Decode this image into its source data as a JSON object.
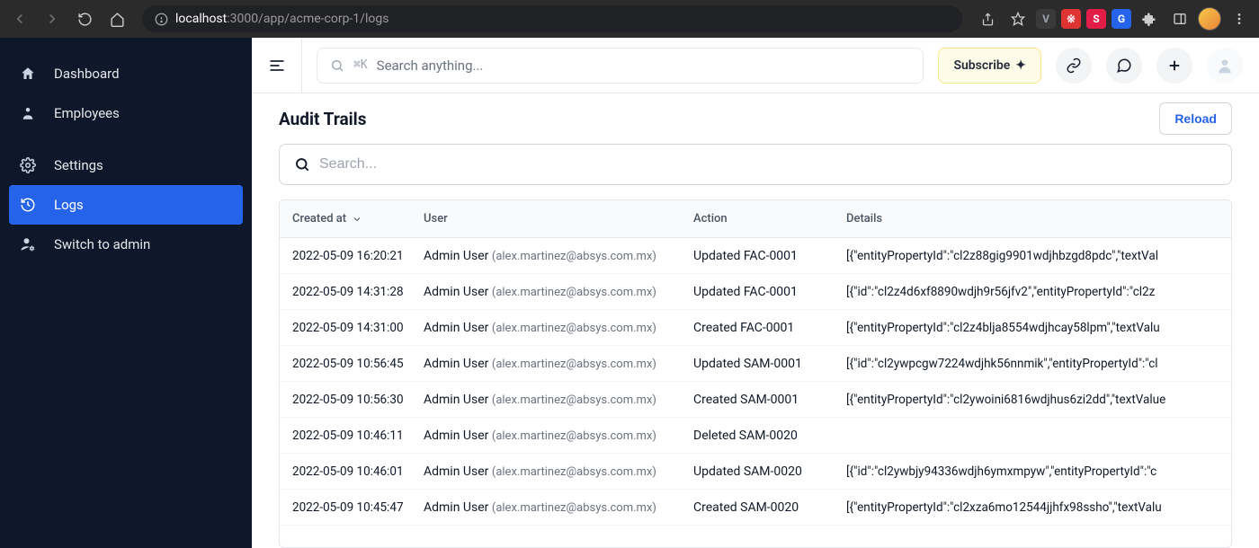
{
  "browser": {
    "url_host": "localhost",
    "url_port_path": ":3000/app/acme-corp-1/logs"
  },
  "sidebar": {
    "items": [
      {
        "icon": "home-icon",
        "label": "Dashboard"
      },
      {
        "icon": "person-icon",
        "label": "Employees"
      }
    ],
    "items2": [
      {
        "icon": "gear-icon",
        "label": "Settings"
      },
      {
        "icon": "history-icon",
        "label": "Logs",
        "active": true
      },
      {
        "icon": "admin-icon",
        "label": "Switch to admin"
      }
    ]
  },
  "topbar": {
    "search_shortcut": "⌘K",
    "search_placeholder": "Search anything...",
    "subscribe_label": "Subscribe"
  },
  "page": {
    "title": "Audit Trails",
    "reload_label": "Reload",
    "table_search_placeholder": "Search..."
  },
  "table": {
    "columns": {
      "created_at": "Created at",
      "user": "User",
      "action": "Action",
      "details": "Details"
    },
    "rows": [
      {
        "created_at": "2022-05-09 16:20:21",
        "user_name": "Admin User",
        "user_email": "(alex.martinez@absys.com.mx)",
        "action": "Updated FAC-0001",
        "details": "[{\"entityPropertyId\":\"cl2z88gig9901wdjhbzgd8pdc\",\"textVal"
      },
      {
        "created_at": "2022-05-09 14:31:28",
        "user_name": "Admin User",
        "user_email": "(alex.martinez@absys.com.mx)",
        "action": "Updated FAC-0001",
        "details": "[{\"id\":\"cl2z4d6xf8890wdjh9r56jfv2\",\"entityPropertyId\":\"cl2z"
      },
      {
        "created_at": "2022-05-09 14:31:00",
        "user_name": "Admin User",
        "user_email": "(alex.martinez@absys.com.mx)",
        "action": "Created FAC-0001",
        "details": "[{\"entityPropertyId\":\"cl2z4blja8554wdjhcay58lpm\",\"textValu"
      },
      {
        "created_at": "2022-05-09 10:56:45",
        "user_name": "Admin User",
        "user_email": "(alex.martinez@absys.com.mx)",
        "action": "Updated SAM-0001",
        "details": "[{\"id\":\"cl2ywpcgw7224wdjhk56nnmik\",\"entityPropertyId\":\"cl"
      },
      {
        "created_at": "2022-05-09 10:56:30",
        "user_name": "Admin User",
        "user_email": "(alex.martinez@absys.com.mx)",
        "action": "Created SAM-0001",
        "details": "[{\"entityPropertyId\":\"cl2ywoini6816wdjhus6zi2dd\",\"textValue"
      },
      {
        "created_at": "2022-05-09 10:46:11",
        "user_name": "Admin User",
        "user_email": "(alex.martinez@absys.com.mx)",
        "action": "Deleted SAM-0020",
        "details": ""
      },
      {
        "created_at": "2022-05-09 10:46:01",
        "user_name": "Admin User",
        "user_email": "(alex.martinez@absys.com.mx)",
        "action": "Updated SAM-0020",
        "details": "[{\"id\":\"cl2ywbjy94336wdjh6ymxmpyw\",\"entityPropertyId\":\"c"
      },
      {
        "created_at": "2022-05-09 10:45:47",
        "user_name": "Admin User",
        "user_email": "(alex.martinez@absys.com.mx)",
        "action": "Created SAM-0020",
        "details": "[{\"entityPropertyId\":\"cl2xza6mo12544jjhfx98ssho\",\"textValu"
      }
    ]
  }
}
